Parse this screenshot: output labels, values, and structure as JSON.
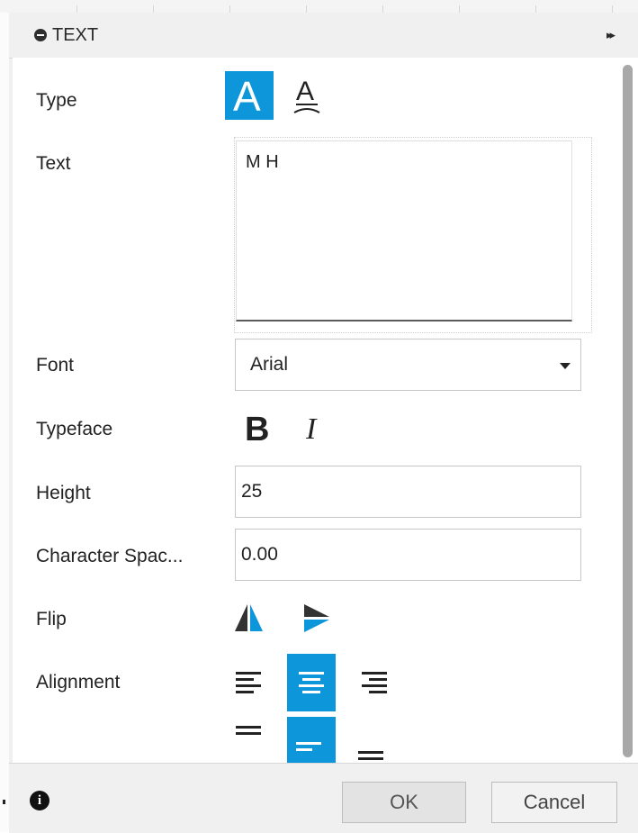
{
  "panel": {
    "title": "TEXT",
    "expand_glyph": "▸▸"
  },
  "labels": {
    "type": "Type",
    "text": "Text",
    "font": "Font",
    "typeface": "Typeface",
    "height": "Height",
    "character_spacing": "Character Spac...",
    "flip": "Flip",
    "alignment": "Alignment"
  },
  "type_options": {
    "horizontal_glyph": "A",
    "on_path_glyph": "A",
    "selected": "horizontal"
  },
  "text_value": "M H",
  "font": {
    "selected": "Arial"
  },
  "typeface": {
    "bold_glyph": "B",
    "italic_glyph": "I"
  },
  "height_value": "25",
  "character_spacing_value": "0.00",
  "alignment": {
    "horizontal_selected": "center",
    "vertical_selected": "middle"
  },
  "footer": {
    "info_glyph": "i",
    "ok_label": "OK",
    "cancel_label": "Cancel"
  },
  "colors": {
    "accent": "#0d96d9",
    "flip_dark": "#333333",
    "panel_bg": "#f0f0f0"
  },
  "icons": [
    "minus-circle-icon",
    "expand-icon",
    "horizontal-text-icon",
    "text-on-path-icon",
    "bold-icon",
    "italic-icon",
    "flip-horizontal-icon",
    "flip-vertical-icon",
    "align-left-icon",
    "align-center-icon",
    "align-right-icon",
    "align-top-icon",
    "align-middle-icon",
    "align-bottom-icon",
    "info-icon",
    "dropdown-arrow-icon"
  ]
}
